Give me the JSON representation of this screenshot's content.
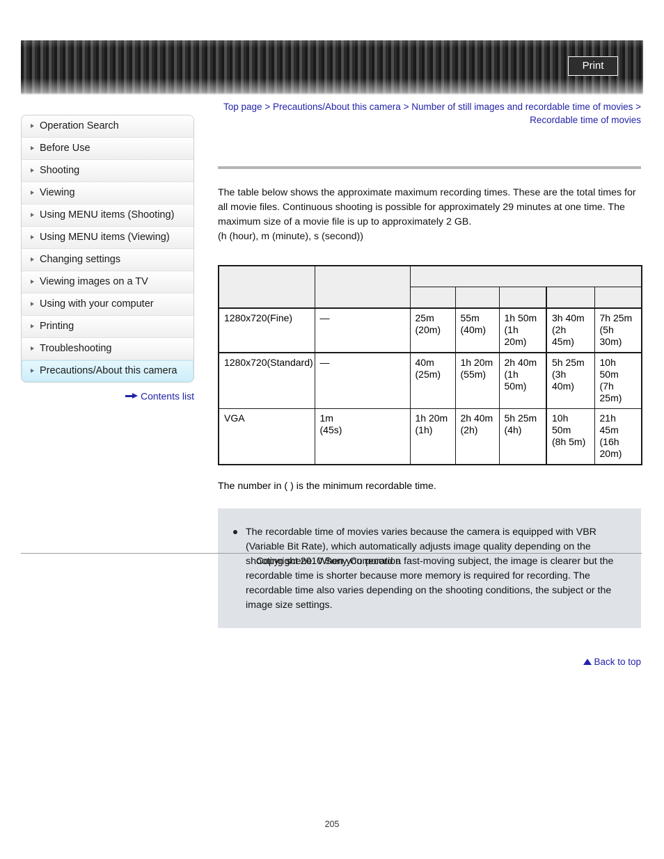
{
  "banner": {
    "print_label": "Print"
  },
  "sidebar": {
    "items": [
      {
        "label": "Operation Search",
        "active": false
      },
      {
        "label": "Before Use",
        "active": false
      },
      {
        "label": "Shooting",
        "active": false
      },
      {
        "label": "Viewing",
        "active": false
      },
      {
        "label": "Using MENU items (Shooting)",
        "active": false
      },
      {
        "label": "Using MENU items (Viewing)",
        "active": false
      },
      {
        "label": "Changing settings",
        "active": false
      },
      {
        "label": "Viewing images on a TV",
        "active": false
      },
      {
        "label": "Using with your computer",
        "active": false
      },
      {
        "label": "Printing",
        "active": false
      },
      {
        "label": "Troubleshooting",
        "active": false
      },
      {
        "label": "Precautions/About this camera",
        "active": true
      }
    ],
    "contents_list_label": "Contents list"
  },
  "breadcrumb": {
    "item1": "Top page",
    "item2": "Precautions/About this camera",
    "item3": "Number of still images and recordable time of movies",
    "item4": "Recordable time of movies",
    "separator": " > "
  },
  "main": {
    "intro_line1": "The table below shows the approximate maximum recording times. These are the total times for all movie files. Continuous shooting is possible for approximately 29 minutes at one time. The maximum size of a movie file is up to approximately 2 GB.",
    "intro_line2": "(h (hour), m (minute), s (second))",
    "min_note": "The number in ( ) is the minimum recordable time.",
    "info_bullet": "The recordable time of movies varies because the camera is equipped with VBR (Variable Bit Rate), which automatically adjusts image quality depending on the shooting scene. When you record a fast-moving subject, the image is clearer but the recordable time is shorter because more memory is required for recording. The recordable time also varies depending on the shooting conditions, the subject or the image size settings.",
    "back_to_top_label": "Back to top"
  },
  "table": {
    "header_row1": [
      "",
      "",
      ""
    ],
    "header_row2": [
      "",
      "",
      "",
      "",
      "",
      "",
      ""
    ],
    "rows": [
      {
        "label": "1280x720(Fine)",
        "internal": "—",
        "cells": [
          "25m\n(20m)",
          "55m\n(40m)",
          "1h 50m\n(1h 20m)",
          "3h 40m\n(2h 45m)",
          "7h 25m\n(5h 30m)"
        ]
      },
      {
        "label": "1280x720(Standard)",
        "internal": "—",
        "cells": [
          "40m\n(25m)",
          "1h 20m\n(55m)",
          "2h 40m\n(1h 50m)",
          "5h 25m\n(3h 40m)",
          "10h 50m\n(7h 25m)"
        ]
      },
      {
        "label": "VGA",
        "internal": "1m\n(45s)",
        "cells": [
          "1h 20m\n(1h)",
          "2h 40m\n(2h)",
          "5h 25m\n(4h)",
          "10h 50m\n(8h 5m)",
          "21h 45m\n(16h 20m)"
        ]
      }
    ]
  },
  "footer": {
    "copyright": "Copyright 2010 Sony Corporation",
    "page_number": "205"
  }
}
